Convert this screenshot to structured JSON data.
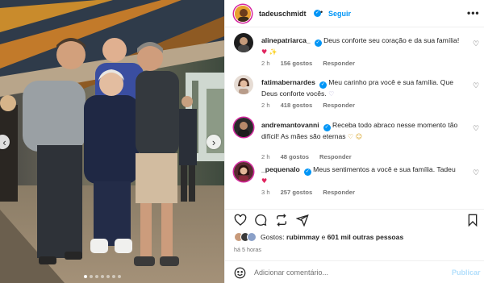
{
  "post": {
    "author": "tadeuschmidt",
    "separator": "•",
    "follow_label": "Seguir",
    "more_label": "•••",
    "carousel": {
      "active_index": 0,
      "count": 7
    }
  },
  "comments": [
    {
      "username": "alinepatriarca_",
      "verified": true,
      "text": "Deus conforte seu coração e da sua família!",
      "emojis": "♥ ✨",
      "age": "2 h",
      "likes": "156 gostos",
      "reply": "Responder"
    },
    {
      "username": "fatimabernardes",
      "verified": true,
      "text": "Meu carinho pra você e sua família. Que Deus conforte vocês.",
      "emojis": "♡",
      "age": "2 h",
      "likes": "418 gostos",
      "reply": "Responder"
    },
    {
      "username": "andremantovanni",
      "verified": true,
      "text": "Receba todo abraco nesse momento tão difícil! As mães são eternas",
      "emojis": "♡ ☺",
      "age": "2 h",
      "likes": "48 gostos",
      "reply": "Responder"
    },
    {
      "username": "_pequenalo",
      "verified": true,
      "text": "Meus sentimentos a você e sua família. Tadeu",
      "emojis": "♥",
      "age": "3 h",
      "likes": "257 gostos",
      "reply": "Responder"
    }
  ],
  "likes_summary": {
    "prefix": "Gostos:",
    "first_user": "rubimmay",
    "connector": "e",
    "others": "601 mil outras pessoas"
  },
  "posted_ago": "há 5 horas",
  "add_comment": {
    "placeholder": "Adicionar comentário...",
    "publish_label": "Publicar"
  },
  "icons": [
    "like-icon",
    "comment-icon",
    "share-icon",
    "send-icon",
    "save-icon",
    "emoji-icon"
  ],
  "colors": {
    "link_blue": "#0095f6",
    "publish_disabled": "#b2dffc",
    "like_red": "#e0245e"
  }
}
